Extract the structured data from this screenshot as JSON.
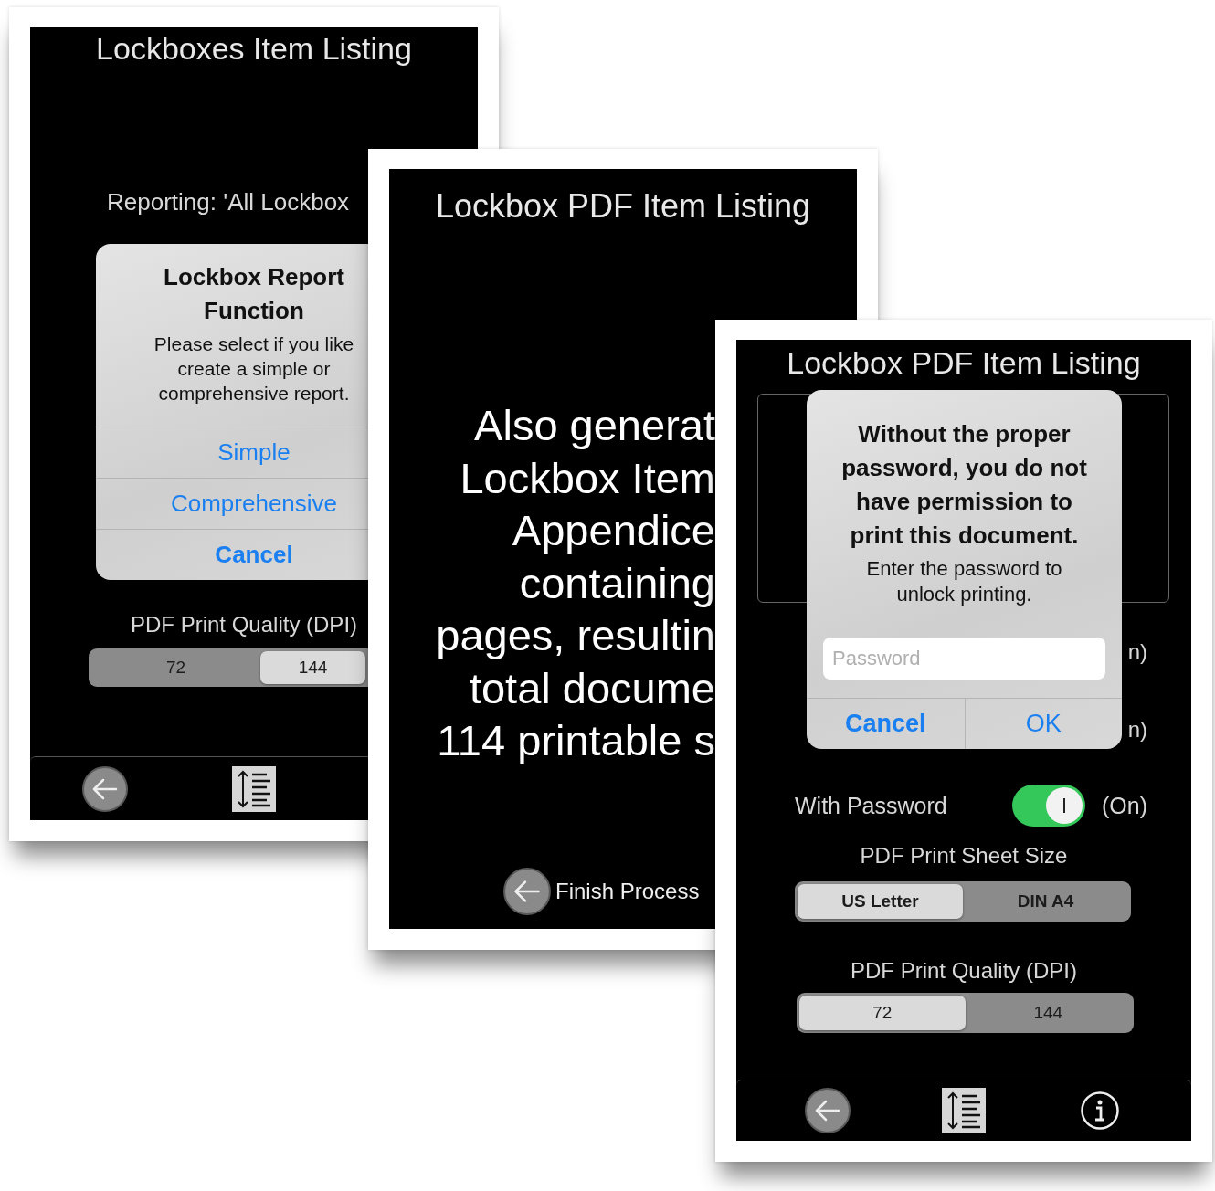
{
  "report_screen": {
    "title": "Lockboxes Item Listing",
    "reporting": "Reporting: 'All Lockbox",
    "dialog": {
      "title": "Lockbox Report\nFunction",
      "message": "Please select if you like\ncreate a simple or\ncomprehensive report.",
      "actions": [
        {
          "label": "Simple",
          "bold": false
        },
        {
          "label": "Comprehensive",
          "bold": false
        },
        {
          "label": "Cancel",
          "bold": true
        }
      ]
    },
    "quality": {
      "label": "PDF Print Quality (DPI)",
      "options": [
        {
          "label": "72",
          "selected": false
        },
        {
          "label": "144",
          "selected": true
        }
      ]
    },
    "toolbar": [
      {
        "kind": "back"
      },
      {
        "kind": "sort"
      }
    ]
  },
  "message_screen": {
    "title": "Lockbox PDF Item Listing",
    "message": "Also generat\nLockbox Item\nAppendice\ncontaining\npages, resultin\ntotal docume\n114 printable s",
    "finish": "Finish Process"
  },
  "password_screen": {
    "title": "Lockbox PDF Item Listing",
    "hidden_rows": [
      {
        "text": "n)"
      },
      {
        "text": "n)"
      }
    ],
    "dialog": {
      "title": "Without the proper\npassword, you do not\nhave permission to\nprint this document.",
      "message": "Enter the password to\nunlock printing.",
      "placeholder": "Password",
      "actions": [
        {
          "label": "Cancel",
          "bold": true
        },
        {
          "label": "OK",
          "bold": false
        }
      ]
    },
    "password_toggle": {
      "label": "With Password",
      "on": true,
      "reading": "(On)"
    },
    "sheet_size": {
      "label": "PDF Print Sheet Size",
      "options": [
        {
          "label": "US Letter",
          "selected": true
        },
        {
          "label": "DIN A4",
          "selected": false
        }
      ]
    },
    "quality": {
      "label": "PDF Print Quality (DPI)",
      "options": [
        {
          "label": "72",
          "selected": true
        },
        {
          "label": "144",
          "selected": false
        }
      ]
    },
    "toolbar": [
      {
        "kind": "back"
      },
      {
        "kind": "sort"
      },
      {
        "kind": "info"
      }
    ]
  }
}
